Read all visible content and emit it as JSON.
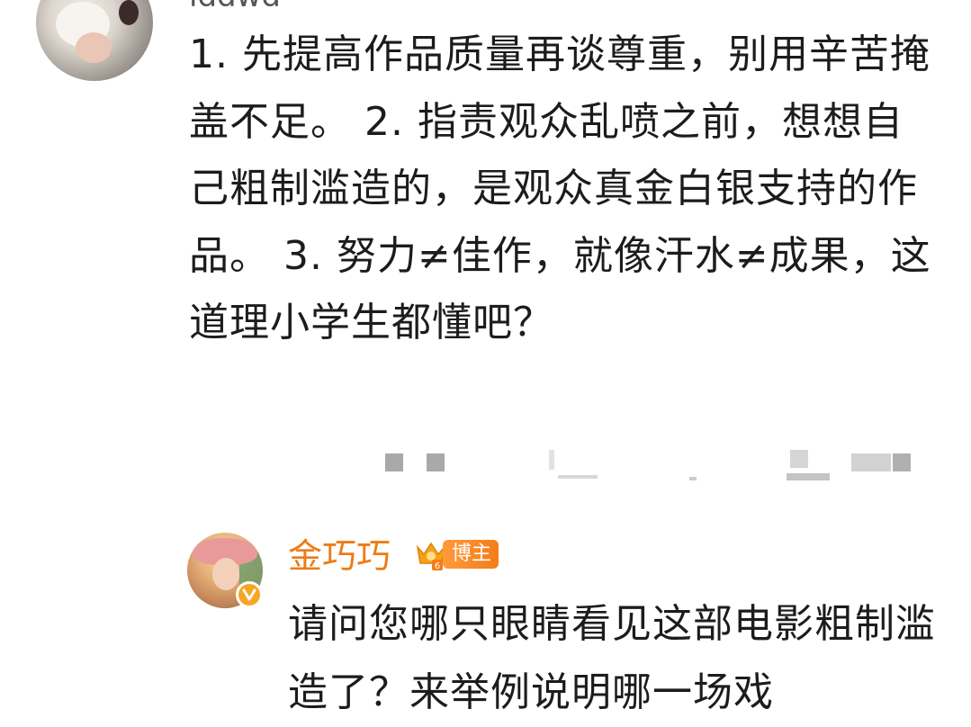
{
  "top_comment": {
    "username_partial": "lddwd",
    "text": "1. 先提高作品质量再谈尊重，别用辛苦掩盖不足。 2. 指责观众乱喷之前，想想自己粗制滥造的，是观众真金白银支持的作品。 3. 努力≠佳作，就像汗水≠成果，这道理小学生都懂吧？"
  },
  "reply": {
    "username": "金巧巧",
    "badge_label": "博主",
    "text": "请问您哪只眼睛看见这部电影粗制滥造了？来举例说明哪一场戏"
  },
  "colors": {
    "username_accent": "#ee7b16",
    "badge_bg": "#f57c18",
    "verified": "#f5a623",
    "text": "#1c1c1c"
  },
  "icons": {
    "vip": "crown-vip-icon",
    "verified": "verified-v-icon"
  }
}
